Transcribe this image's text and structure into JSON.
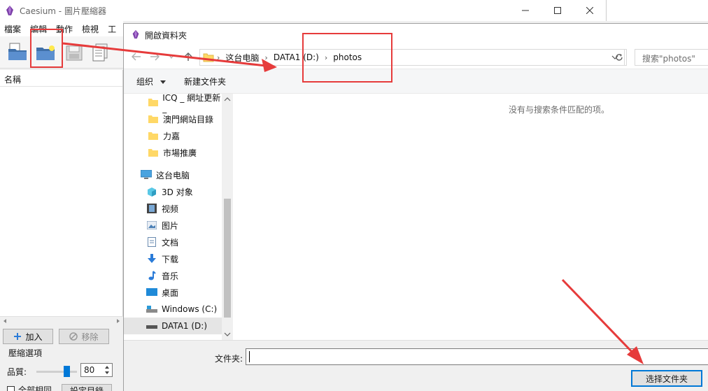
{
  "app": {
    "title": "Caesium - 圖片壓縮器",
    "menu": [
      "檔案",
      "編輯",
      "動作",
      "檢視",
      "工"
    ],
    "list_header": "名稱",
    "add_button": "加入",
    "remove_button": "移除",
    "compress_title": "壓縮選項",
    "quality_label": "品質:",
    "quality_value": "80",
    "quality_percent": 80,
    "all_checkbox_label": "全部相同",
    "custom_button": "設定目錄"
  },
  "dialog": {
    "title": "開啟資料夾",
    "breadcrumb": [
      "这台电脑",
      "DATA1 (D:)",
      "photos"
    ],
    "search_placeholder": "搜索\"photos\"",
    "cmd_organize": "组织",
    "cmd_new_folder": "新建文件夹",
    "nav_items": [
      {
        "label": "ICQ _ 網址更新_",
        "icon": "folder-icon"
      },
      {
        "label": "澳門網站目錄",
        "icon": "folder-icon"
      },
      {
        "label": "力嘉",
        "icon": "folder-icon"
      },
      {
        "label": "市場推廣",
        "icon": "folder-icon"
      },
      {
        "label": "这台电脑",
        "icon": "computer-icon"
      },
      {
        "label": "3D 对象",
        "icon": "cube-3d-icon"
      },
      {
        "label": "视频",
        "icon": "video-icon"
      },
      {
        "label": "图片",
        "icon": "pictures-icon"
      },
      {
        "label": "文档",
        "icon": "document-icon"
      },
      {
        "label": "下载",
        "icon": "download-icon"
      },
      {
        "label": "音乐",
        "icon": "music-icon"
      },
      {
        "label": "桌面",
        "icon": "desktop-icon"
      },
      {
        "label": "Windows (C:)",
        "icon": "drive-c-icon"
      },
      {
        "label": "DATA1 (D:)",
        "icon": "drive-d-icon"
      }
    ],
    "empty_message": "没有与搜索条件匹配的项。",
    "folder_label": "文件夹:",
    "folder_value": "",
    "select_button": "选择文件夹"
  },
  "colors": {
    "accent": "#0078d7",
    "annotation": "#e63b3b",
    "folder": "#ffd866"
  }
}
